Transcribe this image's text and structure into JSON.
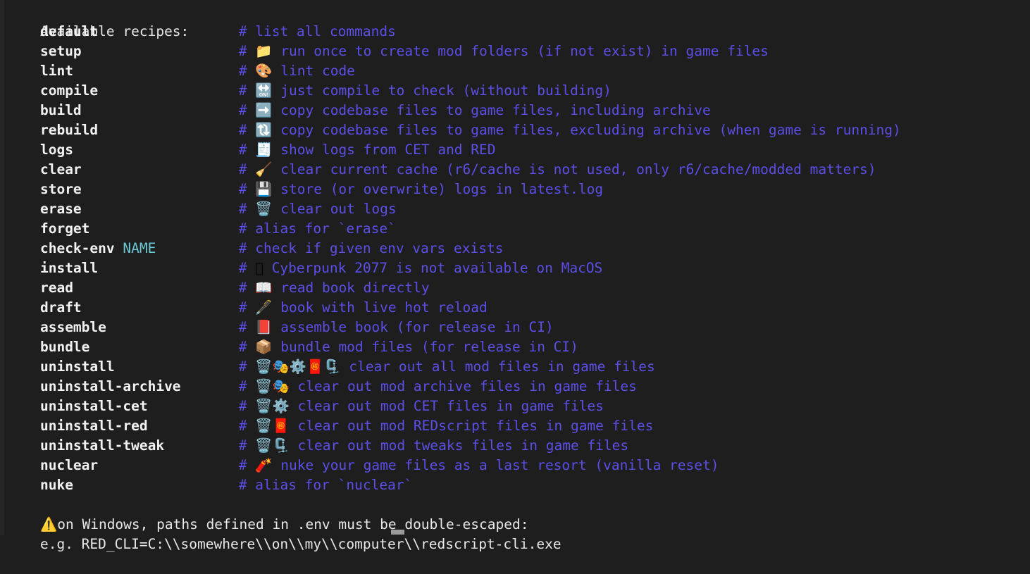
{
  "terminal": {
    "background": "#1e1e1e",
    "foreground": "#e8e8e8",
    "comment_color": "#5b4fe8",
    "param_color": "#6cc8d4",
    "header": "Available recipes:",
    "name_column_width": 24,
    "recipes": [
      {
        "name": "default",
        "param": "",
        "icon": "",
        "icon_name": "none",
        "comment": "list all commands"
      },
      {
        "name": "setup",
        "param": "",
        "icon": "📁",
        "icon_name": "folder-icon",
        "comment": "run once to create mod folders (if not exist) in game files"
      },
      {
        "name": "lint",
        "param": "",
        "icon": "🎨",
        "icon_name": "artist-palette-icon",
        "comment": "lint code"
      },
      {
        "name": "compile",
        "param": "",
        "icon": "🔛",
        "icon_name": "on-arrow-icon",
        "comment": "just compile to check (without building)"
      },
      {
        "name": "build",
        "param": "",
        "icon": "➡️",
        "icon_name": "right-arrow-icon",
        "comment": "copy codebase files to game files, including archive"
      },
      {
        "name": "rebuild",
        "param": "",
        "icon": "🔃",
        "icon_name": "clockwise-arrows-icon",
        "comment": "copy codebase files to game files, excluding archive (when game is running)"
      },
      {
        "name": "logs",
        "param": "",
        "icon": "🧾",
        "icon_name": "receipt-icon",
        "comment": "show logs from CET and RED"
      },
      {
        "name": "clear",
        "param": "",
        "icon": "🧹",
        "icon_name": "broom-icon",
        "comment": "clear current cache (r6/cache is not used, only r6/cache/modded matters)"
      },
      {
        "name": "store",
        "param": "",
        "icon": "💾",
        "icon_name": "floppy-disk-icon",
        "comment": "store (or overwrite) logs in latest.log"
      },
      {
        "name": "erase",
        "param": "",
        "icon": "🗑️",
        "icon_name": "wastebasket-receipt-icon",
        "comment": "clear out logs"
      },
      {
        "name": "forget",
        "param": "",
        "icon": "",
        "icon_name": "none",
        "comment": "alias for `erase`"
      },
      {
        "name": "check-env",
        "param": "NAME",
        "icon": "",
        "icon_name": "none",
        "comment": "check if given env vars exists"
      },
      {
        "name": "install",
        "param": "",
        "icon": "",
        "icon_name": "apple-logo-icon",
        "comment": "Cyberpunk 2077 is not available on MacOS"
      },
      {
        "name": "read",
        "param": "",
        "icon": "📖",
        "icon_name": "open-book-icon",
        "comment": "read book directly"
      },
      {
        "name": "draft",
        "param": "",
        "icon": "🖋️",
        "icon_name": "fountain-pen-icon",
        "comment": "book with live hot reload"
      },
      {
        "name": "assemble",
        "param": "",
        "icon": "📕",
        "icon_name": "closed-book-icon",
        "comment": "assemble book (for release in CI)"
      },
      {
        "name": "bundle",
        "param": "",
        "icon": "📦",
        "icon_name": "package-icon",
        "comment": "bundle mod files (for release in CI)"
      },
      {
        "name": "uninstall",
        "param": "",
        "icon": "🗑️🎭⚙️🧧🗜️",
        "icon_name": "wastebasket-masks-gear-envelope-clamp-icons",
        "comment": "clear out all mod files in game files"
      },
      {
        "name": "uninstall-archive",
        "param": "",
        "icon": "🗑️🎭",
        "icon_name": "wastebasket-masks-icons",
        "comment": "clear out mod archive files in game files"
      },
      {
        "name": "uninstall-cet",
        "param": "",
        "icon": "🗑️⚙️",
        "icon_name": "wastebasket-gear-icons",
        "comment": "clear out mod CET files in game files"
      },
      {
        "name": "uninstall-red",
        "param": "",
        "icon": "🗑️🧧",
        "icon_name": "wastebasket-envelope-icons",
        "comment": "clear out mod REDscript files in game files"
      },
      {
        "name": "uninstall-tweak",
        "param": "",
        "icon": "🗑️🗜️",
        "icon_name": "wastebasket-clamp-icons",
        "comment": "clear out mod tweaks files in game files"
      },
      {
        "name": "nuclear",
        "param": "",
        "icon": "🧨",
        "icon_name": "firecracker-icon",
        "comment": "nuke your game files as a last resort (vanilla reset)"
      },
      {
        "name": "nuke",
        "param": "",
        "icon": "",
        "icon_name": "none",
        "comment": "alias for `nuclear`"
      }
    ],
    "footer": {
      "warning_icon": "⚠️",
      "warning_icon_name": "warning-icon",
      "warning_line": "on Windows, paths defined in .env must be double-escaped:",
      "example_line": "e.g. RED_CLI=C:\\\\somewhere\\\\on\\\\my\\\\computer\\\\redscript-cli.exe"
    }
  }
}
